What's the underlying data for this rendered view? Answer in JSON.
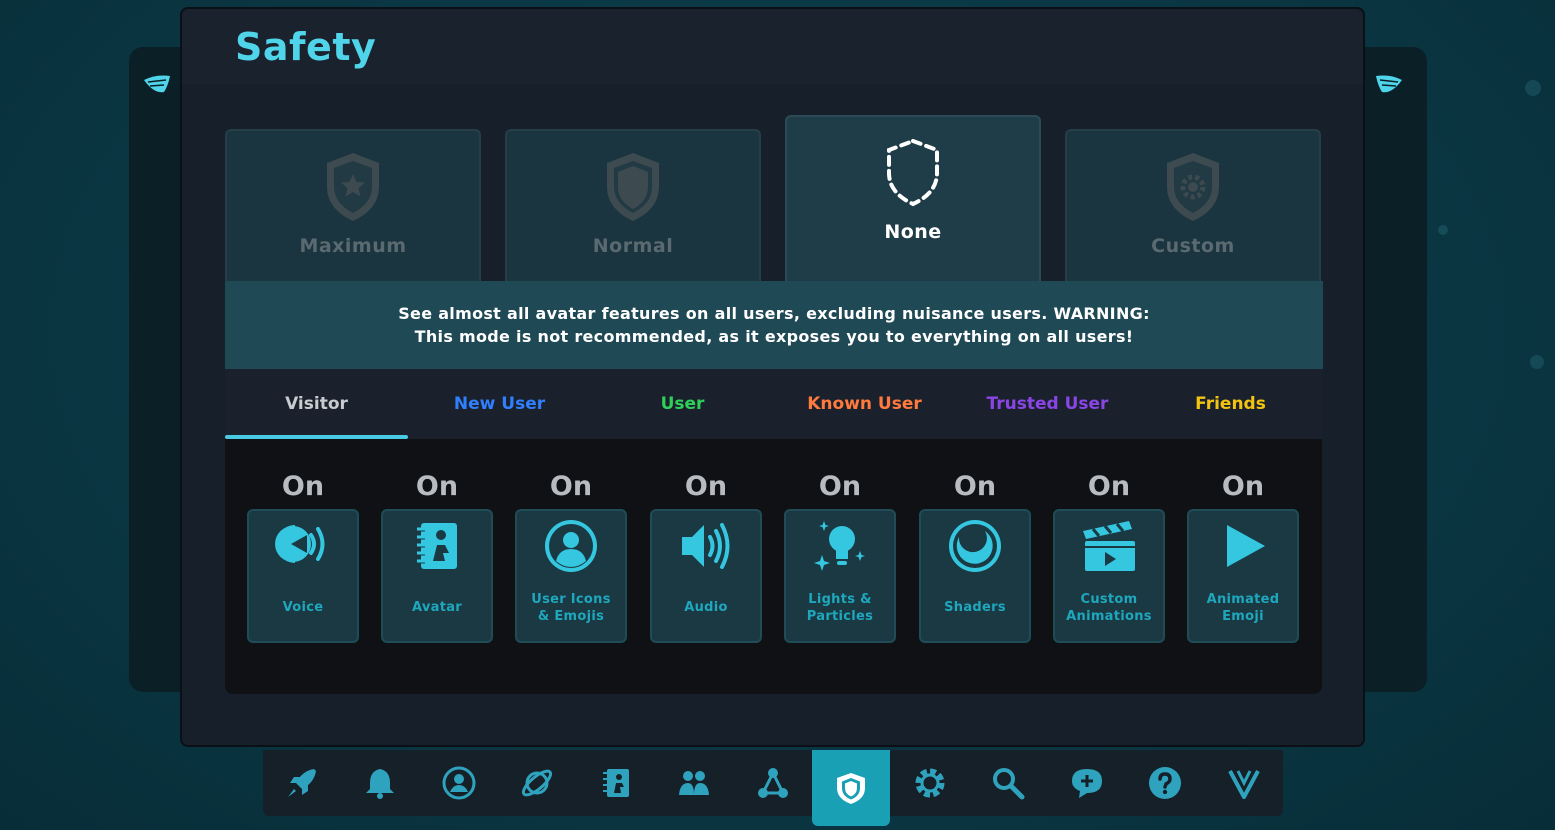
{
  "window": {
    "title": "Safety"
  },
  "presets": [
    {
      "label": "Maximum",
      "icon": "shield-star-icon",
      "active": false
    },
    {
      "label": "Normal",
      "icon": "shield-icon",
      "active": false
    },
    {
      "label": "None",
      "icon": "dashed-shield-icon",
      "active": true
    },
    {
      "label": "Custom",
      "icon": "shield-gear-icon",
      "active": false
    }
  ],
  "description": {
    "line1": "See almost all avatar features on all users, excluding nuisance users. WARNING:",
    "line2": "This mode is not recommended, as it exposes you to everything on all users!"
  },
  "tabs": [
    {
      "label": "Visitor",
      "color": "#c8ccd0",
      "active": true
    },
    {
      "label": "New User",
      "color": "#2f7fff"
    },
    {
      "label": "User",
      "color": "#2fcf5a"
    },
    {
      "label": "Known User",
      "color": "#ff7a3c"
    },
    {
      "label": "Trusted User",
      "color": "#8a45e6"
    },
    {
      "label": "Friends",
      "color": "#f1c40f"
    }
  ],
  "features": [
    {
      "state": "On",
      "label_line1": "Voice",
      "label_line2": "",
      "icon": "voice-icon"
    },
    {
      "state": "On",
      "label_line1": "Avatar",
      "label_line2": "",
      "icon": "avatar-icon"
    },
    {
      "state": "On",
      "label_line1": "User Icons",
      "label_line2": "& Emojis",
      "icon": "user-icon"
    },
    {
      "state": "On",
      "label_line1": "Audio",
      "label_line2": "",
      "icon": "speaker-icon"
    },
    {
      "state": "On",
      "label_line1": "Lights &",
      "label_line2": "Particles",
      "icon": "lightbulb-icon"
    },
    {
      "state": "On",
      "label_line1": "Shaders",
      "label_line2": "",
      "icon": "shader-moon-icon"
    },
    {
      "state": "On",
      "label_line1": "Custom",
      "label_line2": "Animations",
      "icon": "clapperboard-icon"
    },
    {
      "state": "On",
      "label_line1": "Animated",
      "label_line2": "Emoji",
      "icon": "play-icon"
    }
  ],
  "taskbar": [
    {
      "icon": "rocket-icon"
    },
    {
      "icon": "bell-icon"
    },
    {
      "icon": "profile-icon"
    },
    {
      "icon": "planet-icon"
    },
    {
      "icon": "avatar-book-icon"
    },
    {
      "icon": "friends-icon"
    },
    {
      "icon": "network-icon"
    },
    {
      "icon": "safety-shield-icon",
      "active": true
    },
    {
      "icon": "settings-gear-icon"
    },
    {
      "icon": "search-icon"
    },
    {
      "icon": "chat-plus-icon"
    },
    {
      "icon": "help-icon"
    },
    {
      "icon": "vrchat-logo-icon"
    }
  ],
  "colors": {
    "accent": "#4fd4ea",
    "icon_cyan": "#35c6e0",
    "taskbar_icon": "#2fa3bd"
  }
}
